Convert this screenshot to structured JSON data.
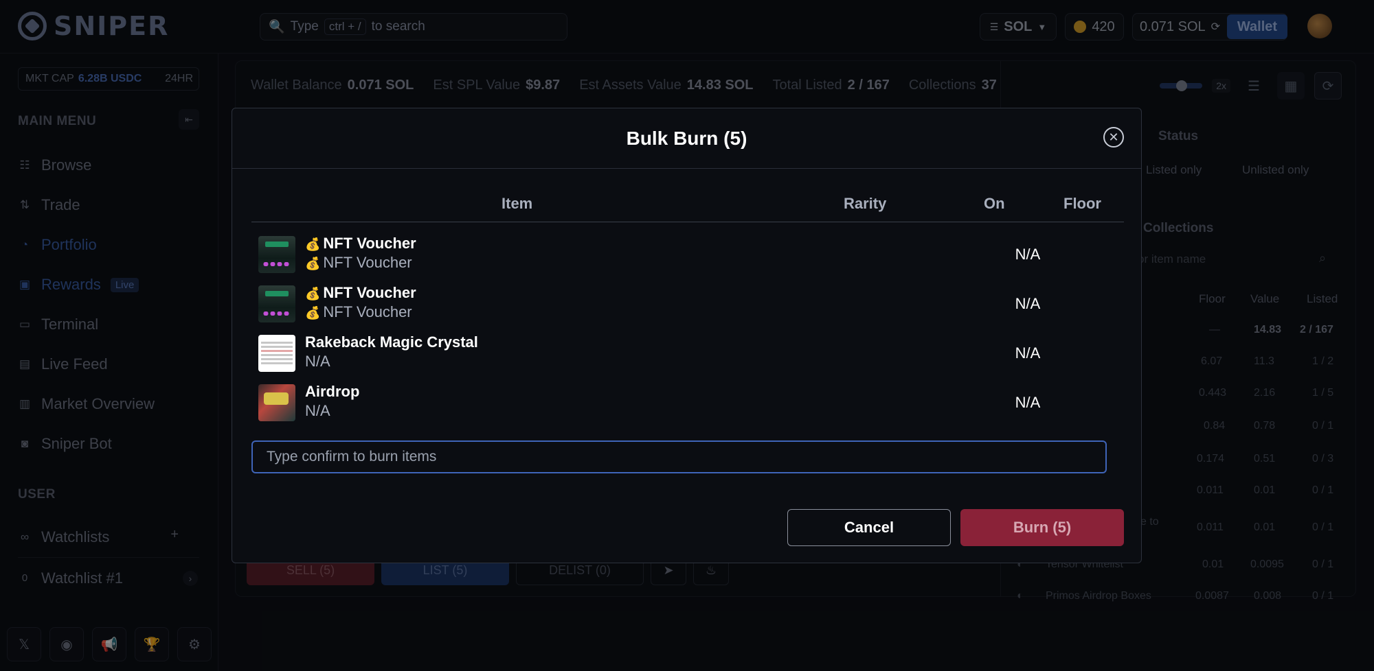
{
  "header": {
    "logo_text": "SNIPER",
    "search_type": "Type",
    "search_shortcut": "ctrl + /",
    "search_suffix": "to search",
    "currency": "SOL",
    "points": "420",
    "balance": "0.071 SOL",
    "wallet_label": "Wallet"
  },
  "sidebar": {
    "mktcap_label": "MKT CAP",
    "mktcap_value": "6.28B USDC",
    "mktcap_period": "24HR",
    "main_menu_title": "MAIN MENU",
    "items": [
      {
        "label": "Browse",
        "icon": "browse-icon"
      },
      {
        "label": "Trade",
        "icon": "trade-icon"
      },
      {
        "label": "Portfolio",
        "icon": "portfolio-icon"
      },
      {
        "label": "Rewards",
        "icon": "gift-icon",
        "badge": "Live"
      },
      {
        "label": "Terminal",
        "icon": "monitor-icon"
      },
      {
        "label": "Live Feed",
        "icon": "feed-icon"
      },
      {
        "label": "Market Overview",
        "icon": "chart-icon"
      },
      {
        "label": "Sniper Bot",
        "icon": "bot-icon"
      }
    ],
    "user_title": "USER",
    "watchlists_label": "Watchlists",
    "watchlist_item": "Watchlist #1",
    "watchlist_count": "0"
  },
  "main": {
    "stats": [
      {
        "label": "Wallet Balance",
        "value": "0.071 SOL"
      },
      {
        "label": "Est SPL Value",
        "value": "$9.87"
      },
      {
        "label": "Est Assets Value",
        "value": "14.83 SOL"
      },
      {
        "label": "Total Listed",
        "value": "2 / 167"
      },
      {
        "label": "Collections",
        "value": "37"
      }
    ],
    "zoom_label": "2x",
    "actions": {
      "sell": "SELL (5)",
      "list": "LIST (5)",
      "delist": "DELIST (0)"
    }
  },
  "right_panel": {
    "status_title": "Status",
    "listed_only": "Listed only",
    "unlisted_only": "Unlisted only",
    "collections_title": "Collections",
    "search_placeholder": "or item name",
    "columns": [
      "Floor",
      "Value",
      "Listed"
    ],
    "rows": [
      {
        "name": "",
        "floor": "—",
        "value": "14.83",
        "listed": "2 / 167"
      },
      {
        "name": "",
        "floor": "6.07",
        "value": "11.3",
        "listed": "1 / 2"
      },
      {
        "name": "",
        "floor": "0.443",
        "value": "2.16",
        "listed": "1 / 5"
      },
      {
        "name": "",
        "floor": "0.84",
        "value": "0.78",
        "listed": "0 / 1"
      },
      {
        "name": "",
        "floor": "0.174",
        "value": "0.51",
        "listed": "0 / 3"
      },
      {
        "name": "",
        "floor": "0.011",
        "value": "0.01",
        "listed": "0 / 1"
      },
      {
        "name": "ye to",
        "floor": "0.011",
        "value": "0.01",
        "listed": "0 / 1"
      },
      {
        "name": "Tensor Whitelist",
        "floor": "0.01",
        "value": "0.0095",
        "listed": "0 / 1"
      },
      {
        "name": "Primos Airdrop Boxes",
        "floor": "0.0087",
        "value": "0.008",
        "listed": "0 / 1"
      }
    ]
  },
  "modal": {
    "title": "Bulk Burn (5)",
    "columns": {
      "item": "Item",
      "rarity": "Rarity",
      "on": "On",
      "floor": "Floor"
    },
    "items": [
      {
        "name": "NFT Voucher",
        "collection": "NFT Voucher",
        "on": "N/A",
        "emoji": "💰"
      },
      {
        "name": "NFT Voucher",
        "collection": "NFT Voucher",
        "on": "N/A",
        "emoji": "💰"
      },
      {
        "name": "Rakeback Magic Crystal",
        "collection": "N/A",
        "on": "N/A"
      },
      {
        "name": "Airdrop",
        "collection": "N/A",
        "on": "N/A"
      }
    ],
    "confirm_placeholder": "Type confirm to burn items",
    "cancel_label": "Cancel",
    "burn_label": "Burn (5)"
  }
}
